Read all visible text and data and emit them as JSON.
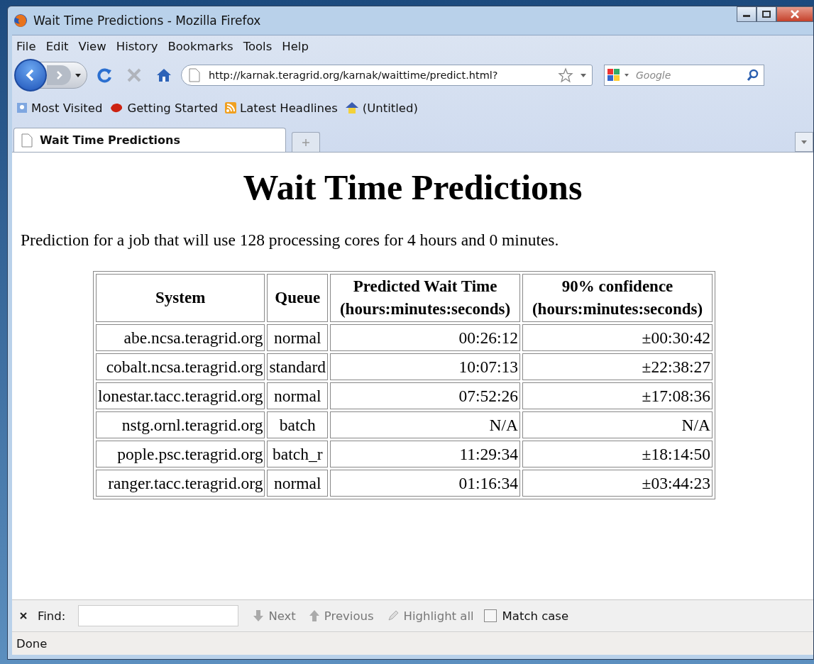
{
  "window": {
    "title": "Wait Time Predictions - Mozilla Firefox"
  },
  "menu": [
    "File",
    "Edit",
    "View",
    "History",
    "Bookmarks",
    "Tools",
    "Help"
  ],
  "address": {
    "value": "http://karnak.teragrid.org/karnak/waittime/predict.html?"
  },
  "search": {
    "placeholder": "Google"
  },
  "bookmarks": [
    "Most Visited",
    "Getting Started",
    "Latest Headlines",
    "(Untitled)"
  ],
  "tabs": [
    {
      "label": "Wait Time Predictions",
      "selected": true
    }
  ],
  "page": {
    "heading": "Wait Time Predictions",
    "intro": "Prediction for a job that will use 128 processing cores for 4 hours and 0 minutes.",
    "table": {
      "columns": [
        "System",
        "Queue",
        "Predicted Wait Time (hours:minutes:seconds)",
        "90% confidence (hours:minutes:seconds)"
      ],
      "rows": [
        [
          "abe.ncsa.teragrid.org",
          "normal",
          "00:26:12",
          "±00:30:42"
        ],
        [
          "cobalt.ncsa.teragrid.org",
          "standard",
          "10:07:13",
          "±22:38:27"
        ],
        [
          "lonestar.tacc.teragrid.org",
          "normal",
          "07:52:26",
          "±17:08:36"
        ],
        [
          "nstg.ornl.teragrid.org",
          "batch",
          "N/A",
          "N/A"
        ],
        [
          "pople.psc.teragrid.org",
          "batch_r",
          "11:29:34",
          "±18:14:50"
        ],
        [
          "ranger.tacc.teragrid.org",
          "normal",
          "01:16:34",
          "±03:44:23"
        ]
      ]
    }
  },
  "find_bar": {
    "label": "Find:",
    "next": "Next",
    "previous": "Previous",
    "highlight": "Highlight all",
    "match_case": {
      "label": "Match case",
      "checked": false
    }
  },
  "status_bar": "Done"
}
